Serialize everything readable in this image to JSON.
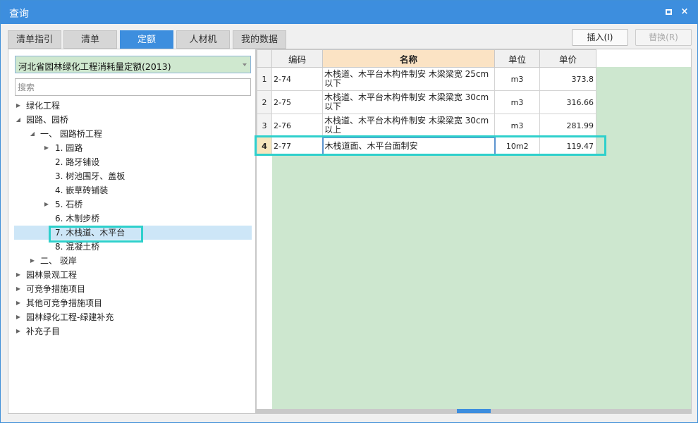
{
  "window": {
    "title": "查询",
    "maximize_icon": "square-icon",
    "close_icon": "x-icon",
    "close_glyph": "×"
  },
  "tabs": [
    {
      "label": "清单指引",
      "active": false
    },
    {
      "label": "清单",
      "active": false
    },
    {
      "label": "定额",
      "active": true
    },
    {
      "label": "人材机",
      "active": false
    },
    {
      "label": "我的数据",
      "active": false
    }
  ],
  "actions": {
    "insert": "插入(I)",
    "replace": "替换(R)"
  },
  "left": {
    "library": "河北省园林绿化工程消耗量定额(2013)",
    "search_placeholder": "搜索",
    "tree": [
      {
        "label": "绿化工程",
        "expanded": false
      },
      {
        "label": "园路、园桥",
        "expanded": true
      },
      {
        "label": "一、 园路桥工程",
        "expanded": true
      },
      {
        "label": "1. 园路",
        "expanded": false
      },
      {
        "label": "2. 路牙铺设"
      },
      {
        "label": "3. 树池围牙、盖板"
      },
      {
        "label": "4. 嵌草砖铺装"
      },
      {
        "label": "5. 石桥",
        "expanded": false
      },
      {
        "label": "6. 木制步桥"
      },
      {
        "label": "7. 木栈道、木平台",
        "selected": true
      },
      {
        "label": "8. 混凝土桥"
      },
      {
        "label": "二、 驳岸",
        "expanded": false
      },
      {
        "label": "园林景观工程",
        "expanded": false
      },
      {
        "label": "可竞争措施项目",
        "expanded": false
      },
      {
        "label": "其他可竞争措施项目",
        "expanded": false
      },
      {
        "label": "园林绿化工程-绿建补充",
        "expanded": false
      },
      {
        "label": "补充子目",
        "expanded": false
      }
    ]
  },
  "grid": {
    "headers": {
      "code": "编码",
      "name": "名称",
      "unit": "单位",
      "price": "单价"
    },
    "rows": [
      {
        "n": "1",
        "code": "2-74",
        "name": "木栈道、木平台木构件制安 木梁梁宽 25cm以下",
        "unit": "m3",
        "price": "373.8"
      },
      {
        "n": "2",
        "code": "2-75",
        "name": "木栈道、木平台木构件制安 木梁梁宽 30cm以下",
        "unit": "m3",
        "price": "316.66"
      },
      {
        "n": "3",
        "code": "2-76",
        "name": "木栈道、木平台木构件制安 木梁梁宽 30cm以上",
        "unit": "m3",
        "price": "281.99"
      },
      {
        "n": "4",
        "code": "2-77",
        "name": "木栈道面、木平台面制安",
        "unit": "10m2",
        "price": "119.47"
      }
    ]
  },
  "colors": {
    "accent": "#3d8ede",
    "highlight": "#2ed0cc",
    "grid_bg": "#cde7cf"
  }
}
